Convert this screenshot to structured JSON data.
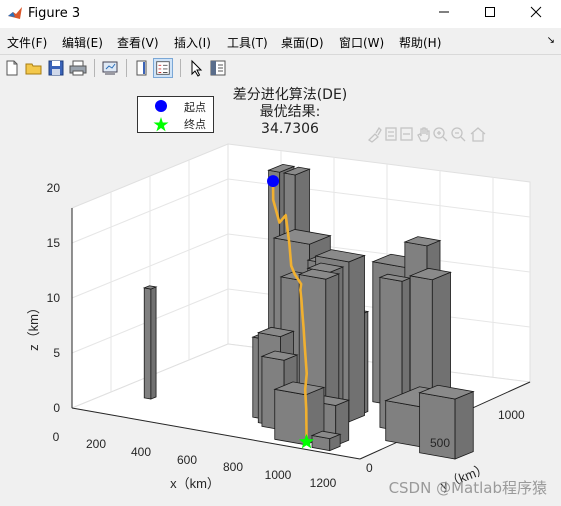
{
  "window": {
    "title": "Figure 3",
    "controls": [
      "minimize",
      "maximize",
      "close"
    ]
  },
  "menu": [
    "文件(F)",
    "编辑(E)",
    "查看(V)",
    "插入(I)",
    "工具(T)",
    "桌面(D)",
    "窗口(W)",
    "帮助(H)"
  ],
  "toolbar": {
    "buttons": [
      "new-figure-icon",
      "open-file-icon",
      "save-icon",
      "print-icon",
      "link-plot-icon",
      "insert-colorbar-icon",
      "insert-legend-icon",
      "edit-plot-arrow-icon",
      "property-inspector-icon"
    ]
  },
  "axes_toolbar": [
    "brush-icon",
    "data-tips-icon",
    "rotate-3d-icon",
    "pan-icon",
    "zoom-in-icon",
    "zoom-out-icon",
    "restore-view-icon"
  ],
  "chart": {
    "title_lines": [
      "差分进化算法(DE)",
      "最优结果:",
      "34.7306"
    ],
    "legend": [
      {
        "label": "起点",
        "color": "#0000ff",
        "marker": "circle"
      },
      {
        "label": "终点",
        "color": "#00ff00",
        "marker": "star"
      }
    ],
    "xlabel": "x（km）",
    "ylabel": "y（km）",
    "zlabel": "z（km）",
    "x_ticks": [
      "0",
      "200",
      "400",
      "600",
      "800",
      "1000",
      "1200"
    ],
    "y_ticks": [
      "0",
      "500",
      "1000"
    ],
    "z_ticks": [
      "0",
      "5",
      "10",
      "15",
      "20"
    ]
  },
  "chart_data": {
    "type": "3d-path",
    "xlim": [
      0,
      1300
    ],
    "ylim": [
      0,
      1200
    ],
    "zlim": [
      0,
      20
    ],
    "grid": true,
    "legend_position": "top-left",
    "path_color": "#f0b030",
    "obstacle_color": "#808080",
    "start": {
      "x": 350,
      "y": 950,
      "z": 19
    },
    "end": {
      "x": 1000,
      "y": 100,
      "z": 0
    }
  },
  "watermark": "CSDN @Matlab程序猿"
}
